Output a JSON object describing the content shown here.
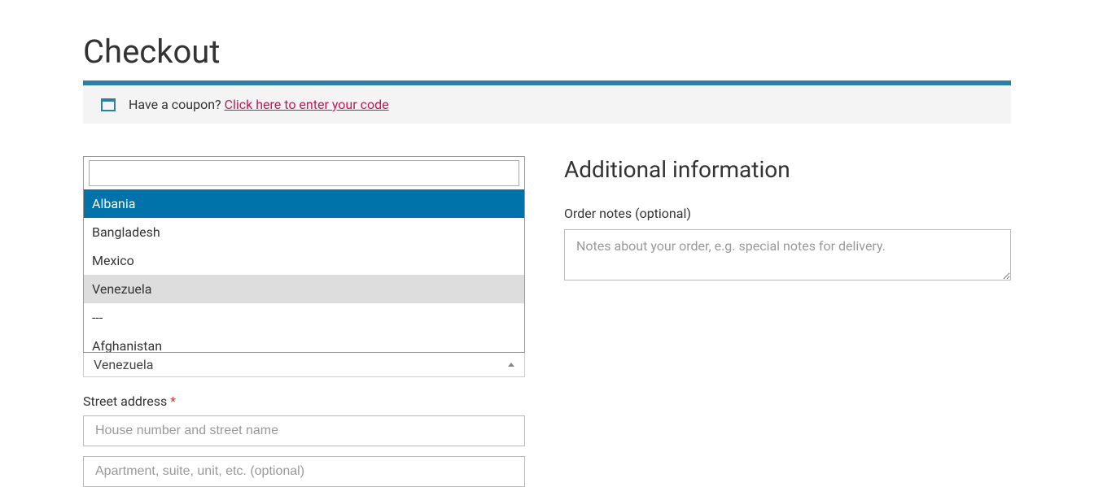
{
  "page": {
    "title": "Checkout"
  },
  "coupon": {
    "prompt": "Have a coupon?",
    "link_text": "Click here to enter your code"
  },
  "billing": {
    "country_search_value": "",
    "country_options": [
      {
        "label": "Albania",
        "highlighted": true,
        "hovered": false
      },
      {
        "label": "Bangladesh",
        "highlighted": false,
        "hovered": false
      },
      {
        "label": "Mexico",
        "highlighted": false,
        "hovered": false
      },
      {
        "label": "Venezuela",
        "highlighted": false,
        "hovered": true
      },
      {
        "label": "---",
        "highlighted": false,
        "hovered": false
      },
      {
        "label": "Afghanistan",
        "highlighted": false,
        "hovered": false
      }
    ],
    "selected_country": "Venezuela",
    "street_label": "Street address",
    "street_placeholder": "House number and street name",
    "street2_placeholder": "Apartment, suite, unit, etc. (optional)",
    "required_mark": "*"
  },
  "additional": {
    "title": "Additional information",
    "notes_label": "Order notes (optional)",
    "notes_placeholder": "Notes about your order, e.g. special notes for delivery."
  }
}
